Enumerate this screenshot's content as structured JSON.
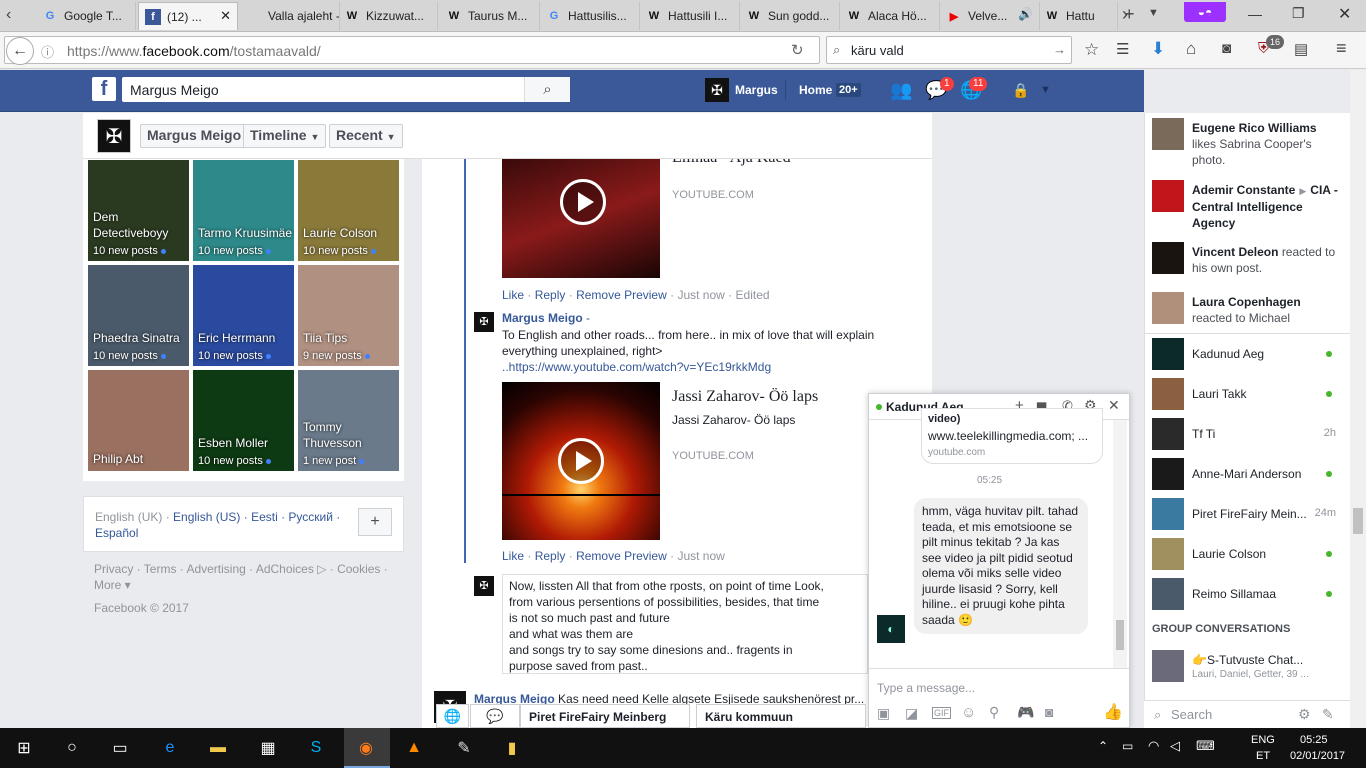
{
  "browser": {
    "tabs": [
      {
        "label": "Google T...",
        "icon": "G"
      },
      {
        "label": "(12) ...",
        "icon": "f"
      },
      {
        "label": "Valla ajaleht -...",
        "icon": ""
      },
      {
        "label": "Kizzuwat...",
        "icon": "W"
      },
      {
        "label": "Taurus M...",
        "icon": "W"
      },
      {
        "label": "Hattusilis...",
        "icon": "G"
      },
      {
        "label": "Hattusili I...",
        "icon": "W"
      },
      {
        "label": "Sun godd...",
        "icon": "W"
      },
      {
        "label": "Alaca Hö...",
        "icon": "W"
      },
      {
        "label": "Velve...",
        "icon": "▶"
      },
      {
        "label": "Hattu",
        "icon": "W"
      }
    ],
    "url_prefix": "https://www.",
    "url_domain": "facebook.com",
    "url_path": "/tostamaavald/",
    "search_text": "käru vald",
    "addon_badge": "16"
  },
  "fb": {
    "logo": "f",
    "search_value": "Margus Meigo",
    "user_name": "Margus",
    "home_label": "Home",
    "home_count": "20+",
    "messages_badge": "1",
    "notif_badge": "11"
  },
  "profile": {
    "name_button": "Margus Meigo",
    "timeline": "Timeline",
    "recent": "Recent"
  },
  "friends": [
    {
      "name": "Dem Detectiveboyy",
      "posts": "10 new posts",
      "color": "#2a3a20"
    },
    {
      "name": "Tarmo Kruusimäe",
      "posts": "10 new posts",
      "color": "#2e8a8a"
    },
    {
      "name": "Laurie Colson",
      "posts": "10 new posts",
      "color": "#8a7a3a"
    },
    {
      "name": "Phaedra Sinatra",
      "posts": "10 new posts",
      "color": "#4a5a6a"
    },
    {
      "name": "Eric Herrmann",
      "posts": "10 new posts",
      "color": "#2a4aa0"
    },
    {
      "name": "Tiia Tips",
      "posts": "9 new posts",
      "color": "#b09080"
    },
    {
      "name": "Philip Abt",
      "posts": "",
      "color": "#9a7060"
    },
    {
      "name": "Esben Moller",
      "posts": "10 new posts",
      "color": "#0d3a12"
    },
    {
      "name": "Tommy Thuvesson",
      "posts": "1 new post",
      "color": "#6a7a8a"
    }
  ],
  "languages": {
    "current": "English (UK) ·",
    "items": [
      "English (US) ·",
      "Eesti ·",
      "Русский ·",
      "Español"
    ],
    "add": "+"
  },
  "footer": {
    "links": "Privacy · Terms · Advertising · AdChoices ▷ · Cookies · More ▾",
    "copyright": "Facebook © 2017"
  },
  "feed": {
    "video1_title": "Ellinaa - Aja Kaed",
    "video1_source": "YOUTUBE.COM",
    "c1_actions": {
      "like": "Like",
      "reply": "Reply",
      "remove": "Remove Preview",
      "time": "Just now",
      "edited": "Edited"
    },
    "c2_author": "Margus Meigo",
    "c2_dash": " -",
    "c2_text": "To English and other roads... from here.. in mix of love that will explain everything unexplained, right>",
    "c2_link": "..https://www.youtube.com/watch?v=YEc19rkkMdg",
    "video2_title": "Jassi Zaharov- Öö laps",
    "video2_desc": "Jassi Zaharov- Öö laps",
    "video2_source": "YOUTUBE.COM",
    "c2_actions": {
      "like": "Like",
      "reply": "Reply",
      "remove": "Remove Preview",
      "time": "Just now"
    },
    "draft_lines": [
      "Now, lissten All that from othe rposts, on point of time Look,",
      "from various persentions of possibilities, besides, that time",
      "is not so much past and future",
      "and what was them are",
      "and songs try to say some dinesions and.. fragents in",
      "purpose saved from past.."
    ],
    "next_author": "Margus Meigo",
    "next_text": "Kas need need Kelle algsete Esjisede saukshenörest pr..."
  },
  "chat": {
    "title": "Kadunud Aeg",
    "prev_snippet": "video)",
    "prev_link": "www.teelekillingmedia.com; ...",
    "prev_source": "youtube.com",
    "time": "05:25",
    "message": "hmm, väga huvitav pilt. tahad teada, et mis emotsioone se pilt minus tekitab ? Ja kas see video ja pilt pidid seotud olema või miks selle video juurde lisasid ? Sorry, kell hiline.. ei pruugi kohe pihta saada 🙂",
    "placeholder": "Type a message..."
  },
  "ticker": [
    {
      "name": "Eugene Rico Williams",
      "text": "likes Sabrina Cooper's photo."
    },
    {
      "name": "Ademir Constante",
      "arrow": "▶",
      "target": "CIA - Central Intelligence Agency",
      "text": ""
    },
    {
      "name": "Vincent Deleon",
      "text": "reacted to his own post."
    },
    {
      "name": "Laura Copenhagen",
      "text": "reacted to Michael"
    }
  ],
  "contacts": [
    {
      "name": "Kadunud Aeg",
      "status": "online",
      "time": ""
    },
    {
      "name": "Lauri Takk",
      "status": "online",
      "time": ""
    },
    {
      "name": "Tf Ti",
      "status": "time",
      "time": "2h"
    },
    {
      "name": "Anne-Mari Anderson",
      "status": "online",
      "time": ""
    },
    {
      "name": "Piret FireFairy Mein...",
      "status": "time",
      "time": "24m"
    },
    {
      "name": "Laurie Colson",
      "status": "online",
      "time": ""
    },
    {
      "name": "Reimo Sillamaa",
      "status": "online",
      "time": ""
    }
  ],
  "group_header": "GROUP CONVERSATIONS",
  "group": {
    "name": "👉S-Tutvuste Chat...",
    "members": "Lauri, Daniel, Getter, 39 ..."
  },
  "sidebar_search": "Search",
  "bottom_tabs": [
    "Piret FireFairy Meinberg",
    "Käru kommuun"
  ],
  "taskbar": {
    "lang1": "ENG",
    "lang2": "ET",
    "time": "05:25",
    "date": "02/01/2017"
  },
  "colors": {
    "fb_blue": "#3b5998",
    "link": "#365899",
    "online": "#42b72a"
  }
}
